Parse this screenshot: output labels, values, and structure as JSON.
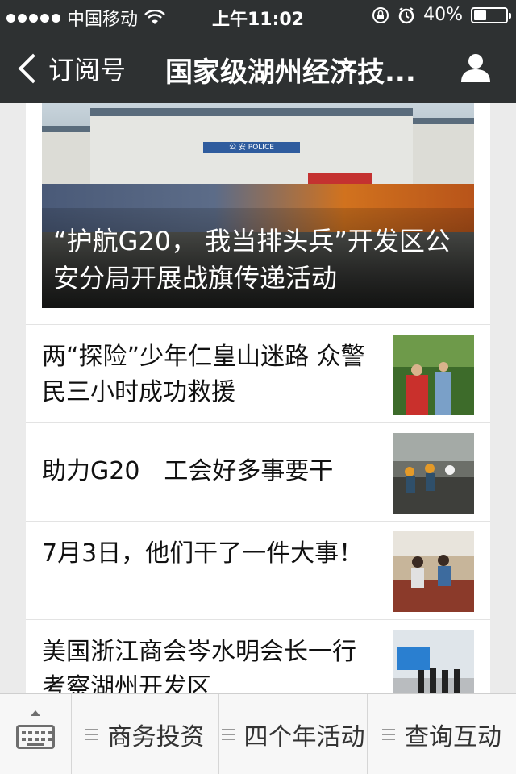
{
  "status_bar": {
    "carrier": "中国移动",
    "time": "上午11:02",
    "battery": "40%",
    "battery_level": 0.4
  },
  "nav": {
    "back_label": "订阅号",
    "title": "国家级湖州经济技..."
  },
  "hero": {
    "sign_text": "公 安 POLICE",
    "caption": "“护航G20， 我当排头兵”开发区公安分局开展战旗传递活动"
  },
  "articles": [
    {
      "title": "两“探险”少年仁皇山迷路 众警民三小时成功救援",
      "thumb": "rescue-photo"
    },
    {
      "title": "助力G20　工会好多事要干",
      "thumb": "workers-photo"
    },
    {
      "title": "7月3日，他们干了一件大事！",
      "thumb": "event-photo"
    },
    {
      "title": "美国浙江商会岑水明会长一行考察湖州开发区",
      "thumb": "visit-photo"
    }
  ],
  "bottom_menu": {
    "tabs": [
      "商务投资",
      "四个年活动",
      "查询互动"
    ]
  },
  "colors": {
    "header_bg": "#2e3132",
    "page_bg": "#ebebeb"
  }
}
